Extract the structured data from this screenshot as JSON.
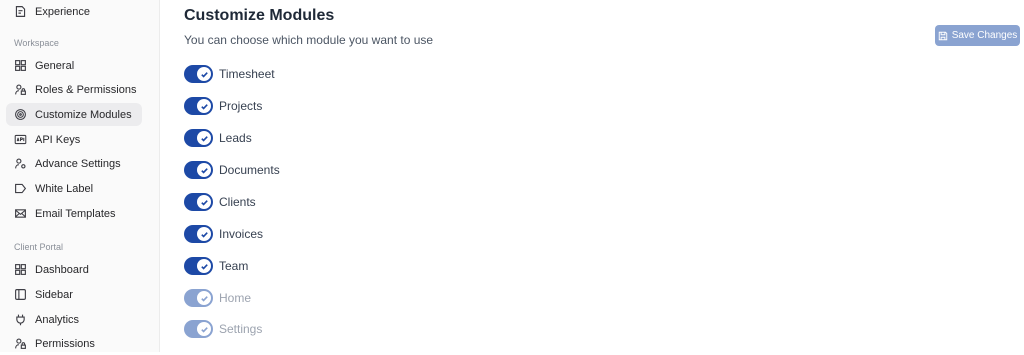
{
  "sidebar": {
    "top_item": {
      "label": "Experience",
      "icon": "edit-document-icon"
    },
    "workspace_label": "Workspace",
    "workspace_items": [
      {
        "label": "General",
        "icon": "grid-icon"
      },
      {
        "label": "Roles & Permissions",
        "icon": "users-lock-icon"
      },
      {
        "label": "Customize Modules",
        "icon": "fingerprint-icon",
        "active": true
      },
      {
        "label": "API Keys",
        "icon": "api-icon"
      },
      {
        "label": "Advance Settings",
        "icon": "user-gear-icon"
      },
      {
        "label": "White Label",
        "icon": "tag-icon"
      },
      {
        "label": "Email Templates",
        "icon": "mail-icon"
      }
    ],
    "portal_label": "Client Portal",
    "portal_items": [
      {
        "label": "Dashboard",
        "icon": "grid-icon"
      },
      {
        "label": "Sidebar",
        "icon": "sidebar-icon"
      },
      {
        "label": "Analytics",
        "icon": "plug-icon"
      },
      {
        "label": "Permissions",
        "icon": "users-lock-icon"
      }
    ]
  },
  "main": {
    "title": "Customize Modules",
    "subtitle": "You can choose which module you want to use",
    "save_label": "Save Changes"
  },
  "modules": [
    {
      "label": "Timesheet",
      "enabled": true,
      "disabled": false
    },
    {
      "label": "Projects",
      "enabled": true,
      "disabled": false
    },
    {
      "label": "Leads",
      "enabled": true,
      "disabled": false
    },
    {
      "label": "Documents",
      "enabled": true,
      "disabled": false
    },
    {
      "label": "Clients",
      "enabled": true,
      "disabled": false
    },
    {
      "label": "Invoices",
      "enabled": true,
      "disabled": false
    },
    {
      "label": "Team",
      "enabled": true,
      "disabled": false
    },
    {
      "label": "Home",
      "enabled": true,
      "disabled": true
    },
    {
      "label": "Settings",
      "enabled": true,
      "disabled": true
    }
  ],
  "colors": {
    "toggle_on": "#1d49a6",
    "toggle_disabled": "#8aa3d1",
    "save_button": "#8aa3d1",
    "active_nav": "#ececee"
  }
}
